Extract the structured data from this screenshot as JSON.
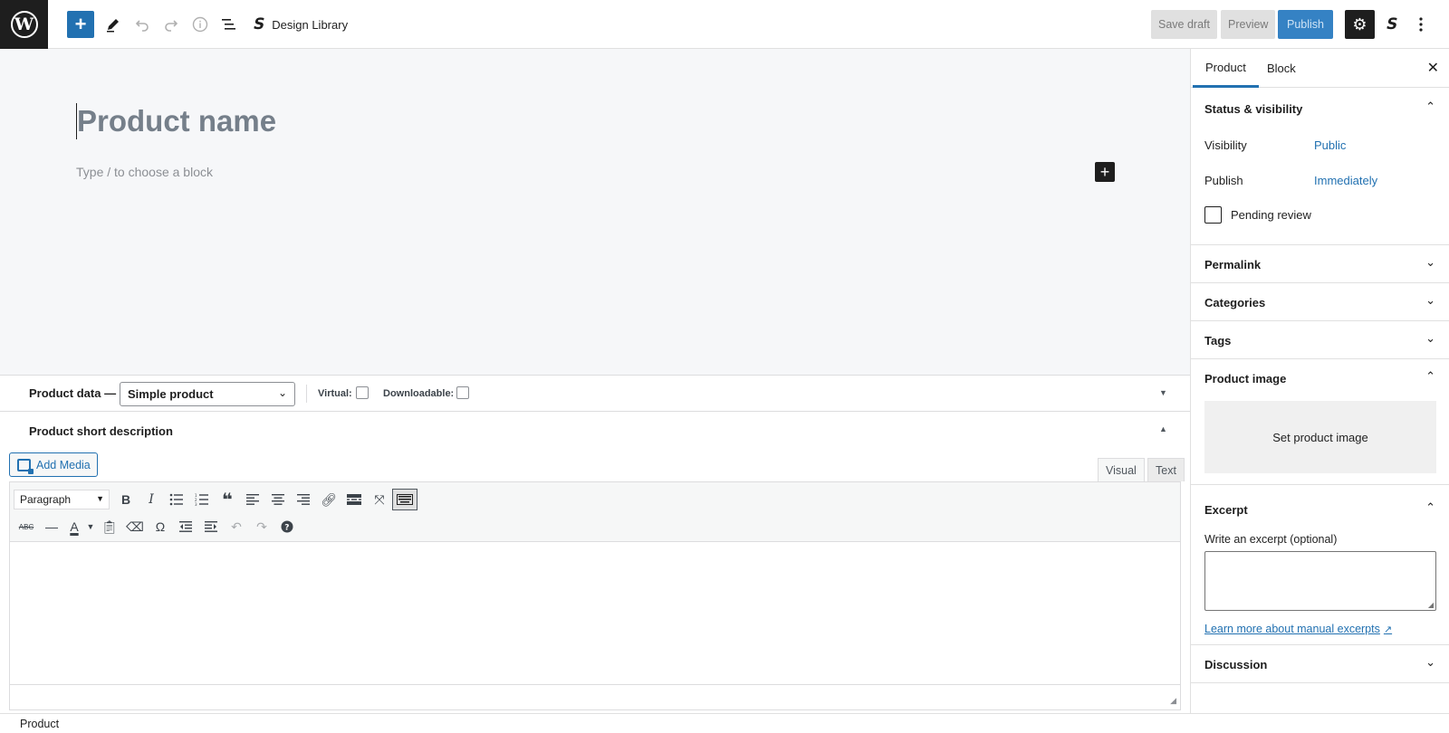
{
  "topbar": {
    "design_library_label": "Design Library",
    "save_draft_label": "Save draft",
    "preview_label": "Preview",
    "publish_label": "Publish"
  },
  "editor": {
    "title_placeholder": "Product name",
    "block_placeholder": "Type / to choose a block"
  },
  "product_data": {
    "label": "Product data —",
    "type_value": "Simple product",
    "virtual_label": "Virtual:",
    "downloadable_label": "Downloadable:"
  },
  "short_description": {
    "title": "Product short description",
    "add_media_label": "Add Media",
    "visual_tab": "Visual",
    "text_tab": "Text",
    "format_value": "Paragraph"
  },
  "footer": {
    "breadcrumb": "Product"
  },
  "sidebar": {
    "tabs": [
      "Product",
      "Block"
    ],
    "status": {
      "title": "Status & visibility",
      "visibility_label": "Visibility",
      "visibility_value": "Public",
      "publish_label": "Publish",
      "publish_value": "Immediately",
      "pending_label": "Pending review"
    },
    "permalink_title": "Permalink",
    "categories_title": "Categories",
    "tags_title": "Tags",
    "product_image": {
      "title": "Product image",
      "set_label": "Set product image"
    },
    "excerpt": {
      "title": "Excerpt",
      "label": "Write an excerpt (optional)",
      "learn_more": "Learn more about manual excerpts"
    },
    "discussion_title": "Discussion"
  }
}
